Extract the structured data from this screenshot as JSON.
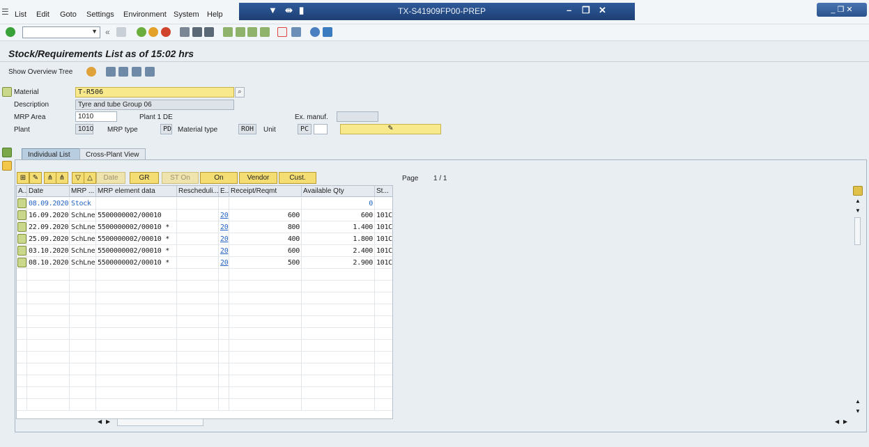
{
  "menu": {
    "items": [
      "List",
      "Edit",
      "Goto",
      "Settings",
      "Environment",
      "System",
      "Help"
    ]
  },
  "window": {
    "title": "TX-S41909FP00-PREP"
  },
  "page": {
    "title": "Stock/Requirements List as of 15:02 hrs"
  },
  "app_toolbar": {
    "show_overview_tree": "Show Overview Tree"
  },
  "header": {
    "material_label": "Material",
    "material_value": "T-R506",
    "description_label": "Description",
    "description_value": "Tyre and tube Group 06",
    "mrp_area_label": "MRP Area",
    "mrp_area_value": "1010",
    "mrp_area_text": "Plant 1 DE",
    "ex_manuf_label": "Ex. manuf.",
    "plant_label": "Plant",
    "plant_value": "1010",
    "mrp_type_label": "MRP type",
    "mrp_type_value": "PD",
    "material_type_label": "Material type",
    "material_type_value": "ROH",
    "unit_label": "Unit",
    "unit_value": "PC"
  },
  "tabs": [
    "Individual List",
    "Cross-Plant View"
  ],
  "grid_buttons": {
    "date": "Date",
    "gr": "GR",
    "st_on": "ST On",
    "on": "On",
    "vendor": "Vendor",
    "cust": "Cust."
  },
  "pagination": {
    "label": "Page",
    "value": "1  /  1"
  },
  "table": {
    "columns": [
      "A..",
      "Date",
      "MRP ...",
      "MRP element data",
      "Rescheduli...",
      "E..",
      "Receipt/Reqmt",
      "Available Qty",
      "St..."
    ],
    "rows": [
      {
        "date": "08.09.2020",
        "mrp": "Stock",
        "element": "",
        "resched": "",
        "e": "",
        "receipt": "",
        "available": "0",
        "st": ""
      },
      {
        "date": "16.09.2020",
        "mrp": "SchLne",
        "element": "5500000002/00010",
        "resched": "",
        "e": "20",
        "receipt": "600",
        "available": "600",
        "st": "101C"
      },
      {
        "date": "22.09.2020",
        "mrp": "SchLne",
        "element": "5500000002/00010 *",
        "resched": "",
        "e": "20",
        "receipt": "800",
        "available": "1.400",
        "st": "101C"
      },
      {
        "date": "25.09.2020",
        "mrp": "SchLne",
        "element": "5500000002/00010 *",
        "resched": "",
        "e": "20",
        "receipt": "400",
        "available": "1.800",
        "st": "101C"
      },
      {
        "date": "03.10.2020",
        "mrp": "SchLne",
        "element": "5500000002/00010 *",
        "resched": "",
        "e": "20",
        "receipt": "600",
        "available": "2.400",
        "st": "101C"
      },
      {
        "date": "08.10.2020",
        "mrp": "SchLne",
        "element": "5500000002/00010 *",
        "resched": "",
        "e": "20",
        "receipt": "500",
        "available": "2.900",
        "st": "101C"
      }
    ]
  }
}
